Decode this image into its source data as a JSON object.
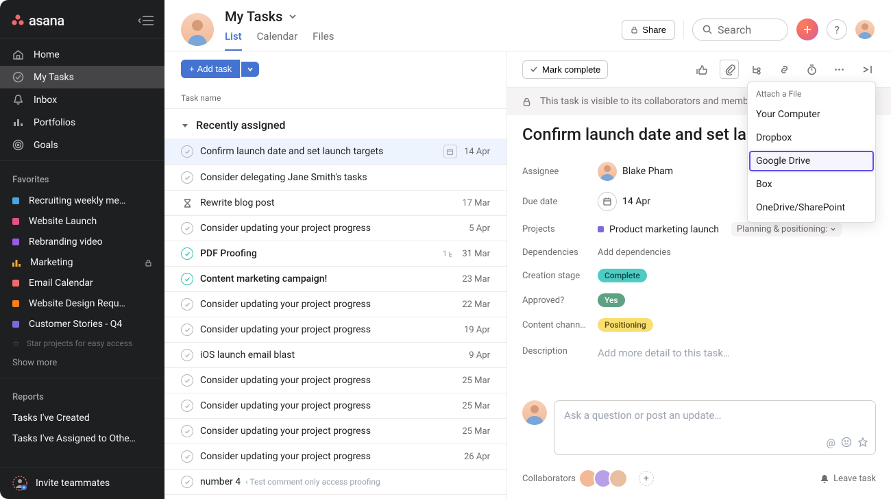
{
  "brand": "asana",
  "sidebar": {
    "nav": [
      {
        "icon": "home",
        "label": "Home"
      },
      {
        "icon": "check",
        "label": "My Tasks"
      },
      {
        "icon": "bell",
        "label": "Inbox"
      },
      {
        "icon": "bars",
        "label": "Portfolios"
      },
      {
        "icon": "target",
        "label": "Goals"
      }
    ],
    "favorites_title": "Favorites",
    "favorites": [
      {
        "color": "#45a8e0",
        "label": "Recruiting weekly me…"
      },
      {
        "color": "#e84f8a",
        "label": "Website Launch"
      },
      {
        "color": "#9b59e0",
        "label": "Rebranding video"
      },
      {
        "color": "#f2a93b",
        "label": "Marketing",
        "locked": true,
        "bar": true
      },
      {
        "color": "#f06a6a",
        "label": "Email Calendar"
      },
      {
        "color": "#fd7e14",
        "label": "Website Design Requ…"
      },
      {
        "color": "#7b69e0",
        "label": "Customer Stories - Q4"
      }
    ],
    "star_hint": "Star projects for easy access",
    "show_more": "Show more",
    "reports_title": "Reports",
    "reports": [
      "Tasks I've Created",
      "Tasks I've Assigned to Othe…"
    ],
    "invite": "Invite teammates"
  },
  "header": {
    "title": "My Tasks",
    "tabs": [
      {
        "label": "List"
      },
      {
        "label": "Calendar"
      },
      {
        "label": "Files"
      }
    ],
    "share": "Share",
    "search_placeholder": "Search"
  },
  "list": {
    "add_task": "Add task",
    "col_header": "Task name",
    "section": "Recently assigned",
    "rows": [
      {
        "name": "Confirm launch date and set launch targets",
        "date": "14 Apr",
        "selected": true,
        "cal": true
      },
      {
        "name": "Consider delegating Jane Smith's tasks",
        "date": ""
      },
      {
        "name": "Rewrite blog post",
        "date": "17 Mar",
        "hourglass": true
      },
      {
        "name": "Consider updating your project progress",
        "date": "5 Apr"
      },
      {
        "name": "PDF Proofing",
        "date": "31 Mar",
        "bold": true,
        "teal": true,
        "subtask": "1"
      },
      {
        "name": "Content  marketing campaign!",
        "date": "23 Mar",
        "bold": true,
        "teal": true
      },
      {
        "name": "Consider updating your project progress",
        "date": "22 Mar"
      },
      {
        "name": "Consider updating your project progress",
        "date": "19 Apr"
      },
      {
        "name": "iOS launch email blast",
        "date": "9 Apr"
      },
      {
        "name": "Consider updating your project progress",
        "date": "25 Mar"
      },
      {
        "name": "Consider updating your project progress",
        "date": "25 Mar"
      },
      {
        "name": "Consider updating your project progress",
        "date": "25 Mar"
      },
      {
        "name": "Consider updating your project progress",
        "date": "26 Apr"
      },
      {
        "name": "number 4",
        "comment": "Test comment only access proofing",
        "date": ""
      }
    ]
  },
  "detail": {
    "mark_complete": "Mark complete",
    "privacy": "This task is visible to its collaborators and members of Sales.",
    "title": "Confirm launch date and set launch targets",
    "fields": {
      "assignee_label": "Assignee",
      "assignee": "Blake Pham",
      "due_label": "Due date",
      "due": "14 Apr",
      "projects_label": "Projects",
      "project": "Product marketing launch",
      "project_tag": "Planning & positioning:",
      "deps_label": "Dependencies",
      "deps_ph": "Add dependencies",
      "stage_label": "Creation stage",
      "stage": "Complete",
      "approved_label": "Approved?",
      "approved": "Yes",
      "channel_label": "Content chann…",
      "channel": "Positioning",
      "desc_label": "Description",
      "desc_ph": "Add more detail to this task…"
    },
    "comment_ph": "Ask a question or post an update…",
    "collab_label": "Collaborators",
    "leave": "Leave task"
  },
  "dropdown": {
    "title": "Attach a File",
    "items": [
      "Your Computer",
      "Dropbox",
      "Google Drive",
      "Box",
      "OneDrive/SharePoint"
    ],
    "highlight_index": 2
  }
}
